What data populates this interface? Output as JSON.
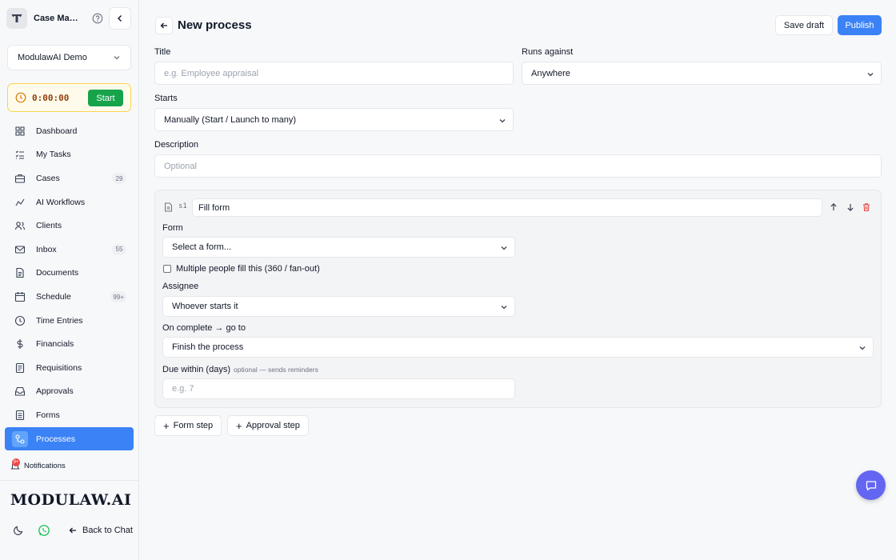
{
  "app": {
    "name": "Case Management",
    "org": "ModulawAI Demo"
  },
  "timer": {
    "value": "0:00:00",
    "start_label": "Start"
  },
  "nav": [
    {
      "label": "Dashboard",
      "icon": "grid-icon",
      "badge": ""
    },
    {
      "label": "My Tasks",
      "icon": "checklist-icon",
      "badge": ""
    },
    {
      "label": "Cases",
      "icon": "briefcase-icon",
      "badge": "29"
    },
    {
      "label": "AI Workflows",
      "icon": "workflow-icon",
      "badge": ""
    },
    {
      "label": "Clients",
      "icon": "users-icon",
      "badge": ""
    },
    {
      "label": "Inbox",
      "icon": "mail-icon",
      "badge": "55"
    },
    {
      "label": "Documents",
      "icon": "document-icon",
      "badge": ""
    },
    {
      "label": "Schedule",
      "icon": "calendar-icon",
      "badge": "99+"
    },
    {
      "label": "Time Entries",
      "icon": "clock-icon",
      "badge": ""
    },
    {
      "label": "Financials",
      "icon": "dollar-icon",
      "badge": ""
    },
    {
      "label": "Requisitions",
      "icon": "requisition-icon",
      "badge": ""
    },
    {
      "label": "Approvals",
      "icon": "inbox-tray-icon",
      "badge": ""
    },
    {
      "label": "Forms",
      "icon": "form-icon",
      "badge": ""
    },
    {
      "label": "Processes",
      "icon": "process-icon",
      "badge": "",
      "active": true
    }
  ],
  "notifications": {
    "label": "Notifications",
    "count": "9+"
  },
  "logo": "MODULAW.AI",
  "footer": {
    "back_label": "Back to Chat"
  },
  "page": {
    "title": "New process",
    "save_draft": "Save draft",
    "publish": "Publish"
  },
  "form": {
    "title_label": "Title",
    "title_placeholder": "e.g. Employee appraisal",
    "runs_against_label": "Runs against",
    "runs_against_value": "Anywhere",
    "starts_label": "Starts",
    "starts_value": "Manually (Start / Launch to many)",
    "description_label": "Description",
    "description_placeholder": "Optional"
  },
  "step": {
    "number": "s1",
    "name": "Fill form",
    "form_label": "Form",
    "form_value": "Select a form...",
    "multi_label": "Multiple people fill this (360 / fan-out)",
    "assignee_label": "Assignee",
    "assignee_value": "Whoever starts it",
    "on_complete_label": "On complete → go to",
    "on_complete_value": "Finish the process",
    "due_label": "Due within (days)",
    "due_hint": "optional — sends reminders",
    "due_placeholder": "e.g. 7"
  },
  "actions": {
    "form_step": "Form step",
    "approval_step": "Approval step"
  },
  "colors": {
    "accent": "#3b82f6",
    "start_green": "#16a34a",
    "danger": "#ef4444",
    "fab": "#6366f1"
  }
}
